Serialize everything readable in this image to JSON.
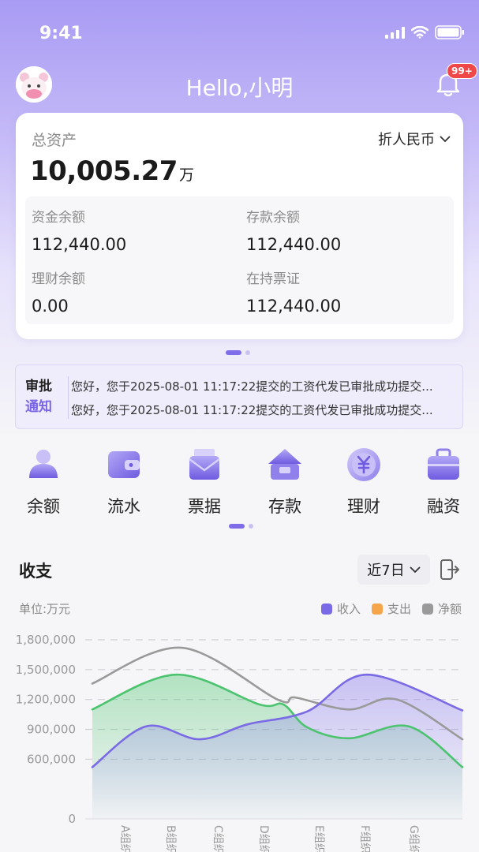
{
  "status_bar": {
    "time": "9:41"
  },
  "header": {
    "greeting": "Hello,小明",
    "notification_badge": "99+"
  },
  "assets_card": {
    "title": "总资产",
    "currency": "折人民币",
    "total_value": "10,005.27",
    "total_unit": "万",
    "items": [
      {
        "label": "资金余额",
        "value": "112,440.00"
      },
      {
        "label": "存款余额",
        "value": "112,440.00"
      },
      {
        "label": "理财余额",
        "value": "0.00"
      },
      {
        "label": "在持票证",
        "value": "112,440.00"
      }
    ]
  },
  "notice": {
    "tag_line1": "审批",
    "tag_line2": "通知",
    "messages": [
      "您好，您于2025-08-01 11:17:22提交的工资代发已审批成功提交...",
      "您好，您于2025-08-01 11:17:22提交的工资代发已审批成功提交..."
    ]
  },
  "quick_menu": [
    {
      "label": "余额",
      "icon": "balance-icon"
    },
    {
      "label": "流水",
      "icon": "wallet-icon"
    },
    {
      "label": "票据",
      "icon": "bill-icon"
    },
    {
      "label": "存款",
      "icon": "deposit-icon"
    },
    {
      "label": "理财",
      "icon": "yuan-coin-icon"
    },
    {
      "label": "融资",
      "icon": "briefcase-icon"
    }
  ],
  "income_section": {
    "title": "收支",
    "range": "近7日",
    "unit_label": "单位:万元"
  },
  "colors": {
    "accent": "#7e6ce8",
    "income": "#7a6ae6",
    "expense": "#f5a64a",
    "net": "#9a9a9a",
    "green_line": "#4cc46f"
  },
  "chart_data": {
    "type": "area",
    "categories": [
      "A组织",
      "B组织",
      "C组织",
      "D组织",
      "E组织",
      "F组织",
      "G组织"
    ],
    "series": [
      {
        "name": "收入",
        "color": "#7a6ae6",
        "values": [
          480000,
          920000,
          800000,
          950000,
          1150000,
          1430000,
          1100000
        ],
        "points": [
          [
            0,
            520000
          ],
          [
            0.9,
            930000
          ],
          [
            1.8,
            800000
          ],
          [
            2.6,
            950000
          ],
          [
            3.6,
            1080000
          ],
          [
            4.6,
            1450000
          ],
          [
            6.2,
            1090000
          ]
        ]
      },
      {
        "name": "支出",
        "color": "#f5a64a",
        "values": []
      },
      {
        "name": "净额",
        "color": "#9a9a9a",
        "values": [
          1350000,
          1700000,
          1200000,
          1200000,
          1050000,
          1200000,
          800000
        ],
        "points": [
          [
            0,
            1360000
          ],
          [
            1.5,
            1720000
          ],
          [
            3.1,
            1200000
          ],
          [
            3.4,
            1220000
          ],
          [
            4.3,
            1100000
          ],
          [
            5.1,
            1200000
          ],
          [
            6.2,
            800000
          ]
        ]
      },
      {
        "name": "",
        "color": "#4cc46f",
        "values": [
          1100000,
          1450000,
          1150000,
          1150000,
          800000,
          930000,
          520000
        ],
        "points": [
          [
            0,
            1100000
          ],
          [
            1.4,
            1450000
          ],
          [
            2.8,
            1150000
          ],
          [
            3.2,
            1150000
          ],
          [
            3.6,
            920000
          ],
          [
            4.3,
            810000
          ],
          [
            5.3,
            930000
          ],
          [
            6.2,
            520000
          ]
        ]
      }
    ],
    "ylim": [
      0,
      1800000
    ],
    "yticks": [
      "0",
      "600,000",
      "900,000",
      "1,200,000",
      "1,500,000",
      "1,800,000"
    ],
    "ytick_values": [
      0,
      600000,
      900000,
      1200000,
      1500000,
      1800000
    ],
    "grid": true,
    "legend": "top-right"
  }
}
